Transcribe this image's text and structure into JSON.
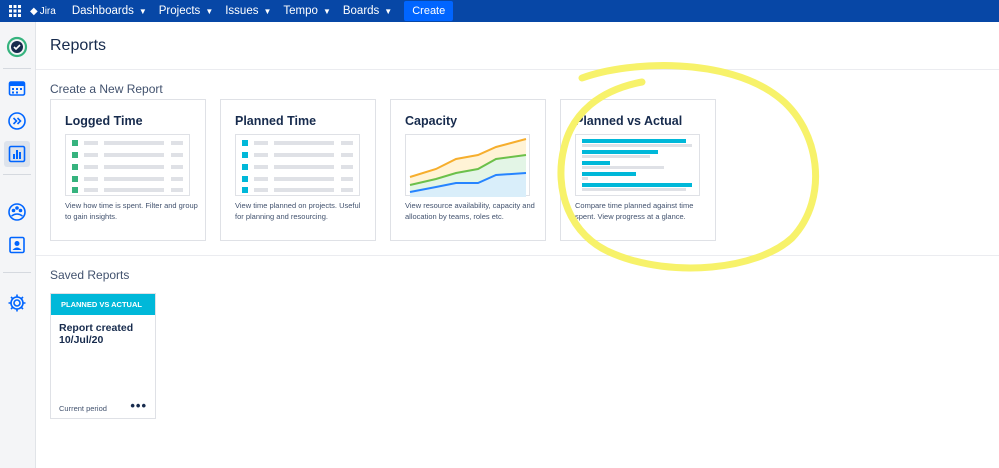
{
  "nav": {
    "brand": "Jira",
    "items": [
      {
        "label": "Dashboards"
      },
      {
        "label": "Projects"
      },
      {
        "label": "Issues"
      },
      {
        "label": "Tempo"
      },
      {
        "label": "Boards"
      }
    ],
    "create_label": "Create",
    "color": "#0747a6"
  },
  "page": {
    "title": "Reports"
  },
  "create_section": {
    "title": "Create a New Report"
  },
  "cards": [
    {
      "title": "Logged Time",
      "desc": "View how time is spent. Filter and group to gain insights.",
      "accent": "#36b37e"
    },
    {
      "title": "Planned Time",
      "desc": "View time planned on projects. Useful for planning and resourcing.",
      "accent": "#00b8d9"
    },
    {
      "title": "Capacity",
      "desc": "View resource availability, capacity and allocation by teams, roles etc."
    },
    {
      "title": "Planned vs Actual",
      "desc": "Compare time planned against time spent. View progress at a glance."
    }
  ],
  "saved_section": {
    "title": "Saved Reports"
  },
  "saved_report": {
    "badge": "PLANNED VS ACTUAL",
    "title": "Report created 10/Jul/20",
    "period": "Current period",
    "more": "•••"
  },
  "highlight_color": "#f7f26a"
}
